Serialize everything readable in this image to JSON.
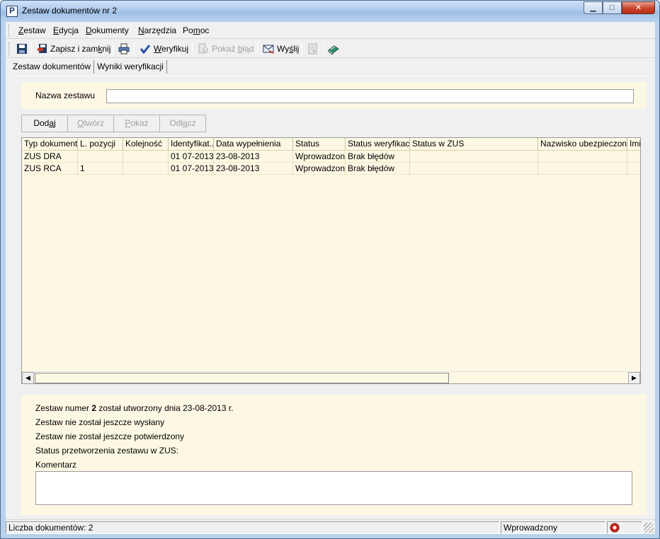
{
  "window": {
    "title": "Zestaw dokumentów nr 2",
    "min_glyph": "▁",
    "max_glyph": "□",
    "close_glyph": "✕"
  },
  "menu": [
    {
      "pre": "",
      "ul": "Z",
      "post": "estaw"
    },
    {
      "pre": "",
      "ul": "E",
      "post": "dycja"
    },
    {
      "pre": "",
      "ul": "D",
      "post": "okumenty"
    },
    {
      "pre": "",
      "ul": "N",
      "post": "arzędzia"
    },
    {
      "pre": "Po",
      "ul": "m",
      "post": "oc"
    }
  ],
  "toolbar": {
    "save_close": {
      "pre": "Zapisz i zam",
      "ul": "k",
      "post": "nij"
    },
    "verify": {
      "pre": "",
      "ul": "W",
      "post": "eryfikuj"
    },
    "show_error": {
      "pre": "Pokaż ",
      "ul": "b",
      "post": "łąd"
    },
    "send": {
      "pre": "Wy",
      "ul": "ś",
      "post": "lij"
    }
  },
  "tabs": [
    "Zestaw dokumentów",
    "Wyniki weryfikacji"
  ],
  "set_name": {
    "label": "Nazwa zestawu",
    "value": ""
  },
  "buttons": [
    {
      "pre": "Dod",
      "ul": "a",
      "post": "j",
      "enabled": true
    },
    {
      "pre": "",
      "ul": "O",
      "post": "twórz",
      "enabled": false
    },
    {
      "pre": "",
      "ul": "P",
      "post": "okaż",
      "enabled": false
    },
    {
      "pre": "Odł",
      "ul": "ą",
      "post": "cz",
      "enabled": false
    }
  ],
  "grid": {
    "columns": [
      "Typ dokumentu",
      "L. pozycji",
      "Kolejność",
      "Identyfikat...",
      "Data wypełnienia",
      "Status",
      "Status weryfikacji",
      "Status w ZUS",
      "Nazwisko ubezpieczon...",
      "Imi"
    ],
    "rows": [
      [
        "ZUS DRA",
        "",
        "",
        "01 07-2013",
        "23-08-2013",
        "Wprowadzony",
        "Brak błędów",
        "",
        "",
        ""
      ],
      [
        "ZUS RCA",
        "1",
        "",
        "01 07-2013",
        "23-08-2013",
        "Wprowadzony",
        "Brak błędów",
        "",
        "",
        ""
      ]
    ]
  },
  "info": {
    "line1_pre": "Zestaw numer ",
    "line1_num": "2",
    "line1_post": " został utworzony dnia 23-08-2013 r.",
    "line2": "Zestaw nie został jeszcze wysłany",
    "line3": "Zestaw nie został jeszcze potwierdzony",
    "line4": "Status przetworzenia zestawu w ZUS:",
    "comment_label": "Komentarz",
    "comment_value": ""
  },
  "statusbar": {
    "count": "Liczba dokumentów: 2",
    "status": "Wprowadzony"
  },
  "colors": {
    "panel_bg": "#fdf8e4",
    "chrome": "#f0f0f0",
    "title_bg": "#a8c6ea"
  }
}
